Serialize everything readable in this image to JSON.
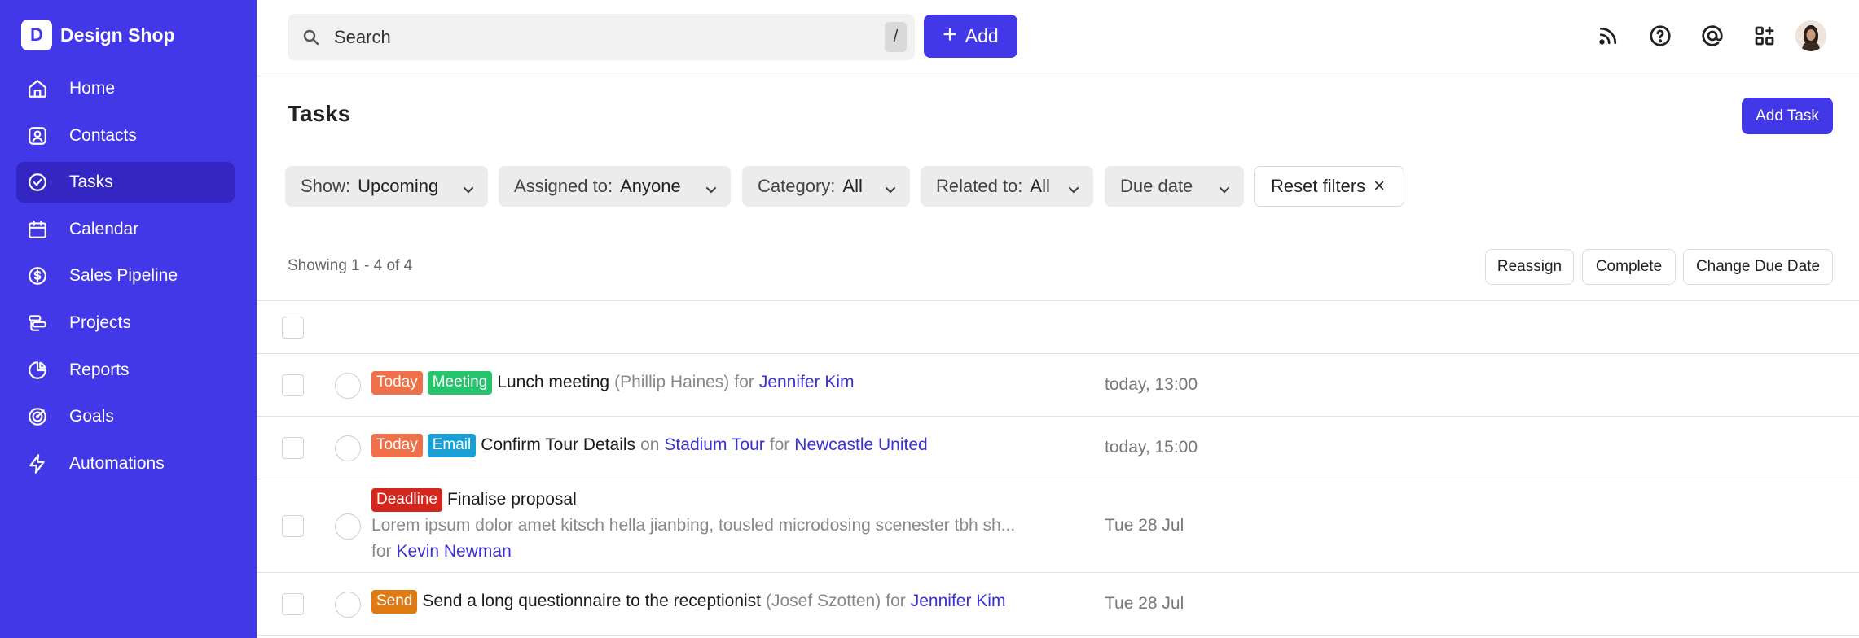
{
  "brand": {
    "logo_letter": "D",
    "name": "Design Shop"
  },
  "sidebar": {
    "items": [
      {
        "label": "Home",
        "icon": "home-icon"
      },
      {
        "label": "Contacts",
        "icon": "contacts-icon"
      },
      {
        "label": "Tasks",
        "icon": "tasks-icon",
        "active": true
      },
      {
        "label": "Calendar",
        "icon": "calendar-icon"
      },
      {
        "label": "Sales Pipeline",
        "icon": "dollar-icon"
      },
      {
        "label": "Projects",
        "icon": "projects-icon"
      },
      {
        "label": "Reports",
        "icon": "pie-chart-icon"
      },
      {
        "label": "Goals",
        "icon": "target-icon"
      },
      {
        "label": "Automations",
        "icon": "lightning-icon"
      }
    ]
  },
  "topbar": {
    "search_placeholder": "Search",
    "search_shortcut": "/",
    "add_label": "Add",
    "icons": [
      "rss-icon",
      "help-icon",
      "at-icon",
      "apps-icon",
      "avatar"
    ]
  },
  "page": {
    "title": "Tasks",
    "add_task_label": "Add Task"
  },
  "filters": [
    {
      "label": "Show:",
      "value": "Upcoming"
    },
    {
      "label": "Assigned to:",
      "value": "Anyone"
    },
    {
      "label": "Category:",
      "value": "All"
    },
    {
      "label": "Related to:",
      "value": "All"
    },
    {
      "label": "Due date",
      "value": ""
    }
  ],
  "reset_filters": {
    "label": "Reset filters",
    "icon": "×"
  },
  "list": {
    "showing": "Showing 1 - 4 of 4",
    "actions": [
      "Reassign",
      "Complete",
      "Change Due Date"
    ]
  },
  "tasks": [
    {
      "badges": [
        "Today",
        "Meeting"
      ],
      "title": "Lunch meeting",
      "person": "(Phillip Haines)",
      "for_word": "for",
      "for_name": "Jennifer Kim",
      "due": "today, 13:00"
    },
    {
      "badges": [
        "Today",
        "Email"
      ],
      "title": "Confirm Tour Details",
      "on_word": "on",
      "on_name": "Stadium Tour",
      "for_word": "for",
      "for_name": "Newcastle United",
      "due": "today, 15:00"
    },
    {
      "badges": [
        "Deadline"
      ],
      "title": "Finalise proposal",
      "description": "Lorem ipsum dolor amet kitsch hella jianbing, tousled microdosing scenester tbh sh...",
      "for_word": "for",
      "for_name": "Kevin Newman",
      "due": "Tue 28 Jul"
    },
    {
      "badges": [
        "Send"
      ],
      "title": "Send a long questionnaire to the receptionist",
      "person": "(Josef Szotten)",
      "for_word": "for",
      "for_name": "Jennifer Kim",
      "due": "Tue 28 Jul"
    }
  ],
  "colors": {
    "sidebar_bg": "#4338e8",
    "accent": "#4338e8",
    "link": "#3a30d6",
    "badge_today": "#f07049",
    "badge_meeting": "#27c46d",
    "badge_email": "#1aa0d6",
    "badge_deadline": "#d4261c",
    "badge_send": "#e07a12"
  }
}
